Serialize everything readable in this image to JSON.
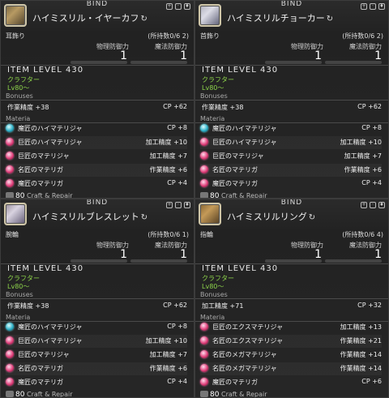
{
  "cards": [
    {
      "bind": "BIND",
      "name": "ハイミスリル・イヤーカフ",
      "hq": "HQ",
      "slot": "耳飾り",
      "owned": "(所持数0/6 2)",
      "def_label": "物理防御力",
      "mdef_label": "魔法防御力",
      "def": "1",
      "mdef": "1",
      "ilvl": "ITEM LEVEL 430",
      "class": "クラフター",
      "level": "Lv80～",
      "bonuses_label": "Bonuses",
      "bonus_left": "作業精度 +38",
      "bonus_right": "CP +62",
      "materia_label": "Materia",
      "materia": [
        {
          "color": "cyan",
          "name": "魔匠のハイマテリジャ",
          "stat": "CP +8"
        },
        {
          "color": "red",
          "name": "巨匠のハイマテリジャ",
          "stat": "加工精度 +10"
        },
        {
          "color": "red",
          "name": "巨匠のマテリジャ",
          "stat": "加工精度 +7"
        },
        {
          "color": "red",
          "name": "名匠のマテリガ",
          "stat": "作業精度 +6"
        },
        {
          "color": "red",
          "name": "魔匠のマテリガ",
          "stat": "CP +4"
        }
      ],
      "footer_num": "80",
      "footer_text": "Craft & Repair"
    },
    {
      "bind": "BIND",
      "name": "ハイミスリルチョーカー",
      "hq": "HQ",
      "slot": "首飾り",
      "owned": "(所持数0/6 2)",
      "def_label": "物理防御力",
      "mdef_label": "魔法防御力",
      "def": "1",
      "mdef": "1",
      "ilvl": "ITEM LEVEL 430",
      "class": "クラフター",
      "level": "Lv80～",
      "bonuses_label": "Bonuses",
      "bonus_left": "作業精度 +38",
      "bonus_right": "CP +62",
      "materia_label": "Materia",
      "materia": [
        {
          "color": "cyan",
          "name": "魔匠のハイマテリジャ",
          "stat": "CP +8"
        },
        {
          "color": "red",
          "name": "巨匠のハイマテリジャ",
          "stat": "加工精度 +10"
        },
        {
          "color": "red",
          "name": "巨匠のマテリジャ",
          "stat": "加工精度 +7"
        },
        {
          "color": "red",
          "name": "名匠のマテリガ",
          "stat": "作業精度 +6"
        },
        {
          "color": "red",
          "name": "魔匠のマテリガ",
          "stat": "CP +4"
        }
      ],
      "footer_num": "80",
      "footer_text": "Craft & Repair"
    },
    {
      "bind": "BIND",
      "name": "ハイミスリルブレスレット",
      "hq": "HQ",
      "slot": "腕輪",
      "owned": "(所持数0/6 1)",
      "def_label": "物理防御力",
      "mdef_label": "魔法防御力",
      "def": "1",
      "mdef": "1",
      "ilvl": "ITEM LEVEL 430",
      "class": "クラフター",
      "level": "Lv80～",
      "bonuses_label": "Bonuses",
      "bonus_left": "作業精度 +38",
      "bonus_right": "CP +62",
      "materia_label": "Materia",
      "materia": [
        {
          "color": "cyan",
          "name": "魔匠のハイマテリジャ",
          "stat": "CP +8"
        },
        {
          "color": "red",
          "name": "巨匠のハイマテリジャ",
          "stat": "加工精度 +10"
        },
        {
          "color": "red",
          "name": "巨匠のマテリジャ",
          "stat": "加工精度 +7"
        },
        {
          "color": "red",
          "name": "名匠のマテリガ",
          "stat": "作業精度 +6"
        },
        {
          "color": "red",
          "name": "魔匠のマテリガ",
          "stat": "CP +4"
        }
      ],
      "footer_num": "80",
      "footer_text": "Craft & Repair"
    },
    {
      "bind": "BIND",
      "name": "ハイミスリルリング",
      "hq": "HQ",
      "slot": "指輪",
      "owned": "(所持数0/6 4)",
      "def_label": "物理防御力",
      "mdef_label": "魔法防御力",
      "def": "1",
      "mdef": "1",
      "ilvl": "ITEM LEVEL 430",
      "class": "クラフター",
      "level": "Lv80～",
      "bonuses_label": "Bonuses",
      "bonus_left": "加工精度 +71",
      "bonus_right": "CP +32",
      "materia_label": "Materia",
      "materia": [
        {
          "color": "red",
          "name": "巨匠のエクスマテリジャ",
          "stat": "加工精度 +13"
        },
        {
          "color": "red",
          "name": "名匠のエクスマテリジャ",
          "stat": "作業精度 +21"
        },
        {
          "color": "red",
          "name": "名匠のメガマテリジャ",
          "stat": "作業精度 +14"
        },
        {
          "color": "red",
          "name": "名匠のメガマテリジャ",
          "stat": "作業精度 +14"
        },
        {
          "color": "red",
          "name": "魔匠のマテリガ",
          "stat": "CP +6"
        }
      ],
      "footer_num": "80",
      "footer_text": "Craft & Repair"
    }
  ]
}
